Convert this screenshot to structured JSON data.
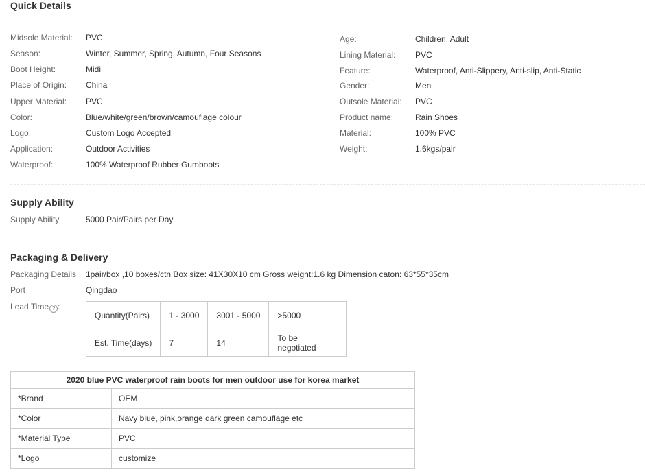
{
  "quick_details": {
    "title": "Quick Details",
    "left": [
      {
        "label": "Midsole Material:",
        "value": "PVC"
      },
      {
        "label": "Season:",
        "value": "Winter, Summer, Spring, Autumn, Four Seasons"
      },
      {
        "label": "Boot Height:",
        "value": "Midi"
      },
      {
        "label": "Place of Origin:",
        "value": "China"
      },
      {
        "label": "Upper Material:",
        "value": "PVC"
      },
      {
        "label": "Color:",
        "value": "Blue/white/green/brown/camouflage colour"
      },
      {
        "label": "Logo:",
        "value": "Custom Logo Accepted"
      },
      {
        "label": "Application:",
        "value": "Outdoor Activities"
      },
      {
        "label": "Waterproof:",
        "value": "100% Waterproof Rubber Gumboots"
      }
    ],
    "right": [
      {
        "label": "Age:",
        "value": "Children, Adult"
      },
      {
        "label": "Lining Material:",
        "value": "PVC"
      },
      {
        "label": "Feature:",
        "value": "Waterproof, Anti-Slippery, Anti-slip, Anti-Static"
      },
      {
        "label": "Gender:",
        "value": "Men"
      },
      {
        "label": "Outsole Material:",
        "value": "PVC"
      },
      {
        "label": "Product name:",
        "value": "Rain Shoes"
      },
      {
        "label": "Material:",
        "value": "100% PVC"
      },
      {
        "label": "Weight:",
        "value": "1.6kgs/pair"
      }
    ]
  },
  "supply": {
    "title": "Supply Ability",
    "label": "Supply Ability",
    "value": "5000 Pair/Pairs per Day"
  },
  "packaging": {
    "title": "Packaging & Delivery",
    "details_label": "Packaging Details",
    "details_value": "1pair/box ,10 boxes/ctn Box size: 41X30X10 cm Gross weight:1.6 kg Dimension caton: 63*55*35cm",
    "port_label": "Port",
    "port_value": "Qingdao",
    "lead_label": "Lead Time",
    "lead_colon": ":",
    "help_glyph": "?",
    "lead_table": {
      "row1": [
        "Quantity(Pairs)",
        "1 - 3000",
        "3001 - 5000",
        ">5000"
      ],
      "row2": [
        "Est. Time(days)",
        "7",
        "14",
        "To be negotiated"
      ]
    }
  },
  "spec_table": {
    "title": "2020  blue PVC waterproof rain boots for men outdoor use for korea market",
    "rows": [
      {
        "key": "*Brand",
        "value": "OEM"
      },
      {
        "key": "*Color",
        "value": "Navy blue, pink,orange dark green camouflage etc"
      },
      {
        "key": "*Material Type",
        "value": "PVC"
      },
      {
        "key": "*Logo",
        "value": "customize"
      }
    ]
  }
}
